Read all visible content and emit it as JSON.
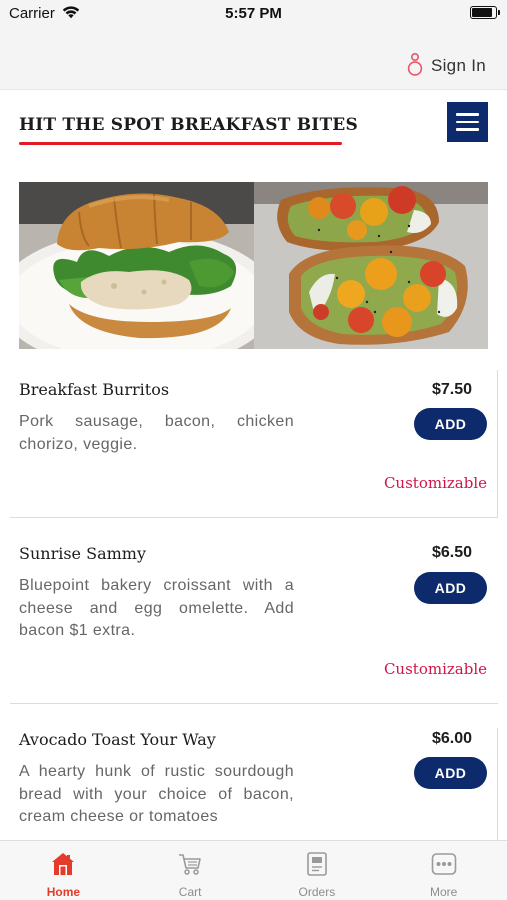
{
  "status_bar": {
    "carrier": "Carrier",
    "time": "5:57 PM",
    "battery_level": 0.85
  },
  "header": {
    "sign_in_label": "Sign In",
    "sign_in_icon": "person-icon"
  },
  "page": {
    "title": "HIT THE SPOT BREAKFAST BITES",
    "menu_icon": "hamburger-menu-icon",
    "hero_image": "croissant sandwich and avocado toast with tomatoes"
  },
  "colors": {
    "brand_navy": "#0d2a6c",
    "accent_red": "#e01b22",
    "customizable_pink": "#d0154a",
    "active_tab": "#e53b2b"
  },
  "items": [
    {
      "name": "Breakfast Burritos",
      "description": "Pork sausage, bacon, chicken chorizo, veggie.",
      "price": "$7.50",
      "add_label": "ADD",
      "customizable_label": "Customizable"
    },
    {
      "name": "Sunrise Sammy",
      "description": "Bluepoint bakery croissant with a cheese and egg omelette. Add bacon $1 extra.",
      "price": "$6.50",
      "add_label": "ADD",
      "customizable_label": "Customizable"
    },
    {
      "name": "Avocado Toast Your Way",
      "description": "A hearty hunk of rustic sourdough bread with your choice of bacon, cream cheese or tomatoes",
      "price": "$6.00",
      "add_label": "ADD"
    }
  ],
  "tabs": [
    {
      "label": "Home",
      "icon": "home-icon",
      "active": true
    },
    {
      "label": "Cart",
      "icon": "cart-icon",
      "active": false
    },
    {
      "label": "Orders",
      "icon": "orders-icon",
      "active": false
    },
    {
      "label": "More",
      "icon": "more-icon",
      "active": false
    }
  ]
}
